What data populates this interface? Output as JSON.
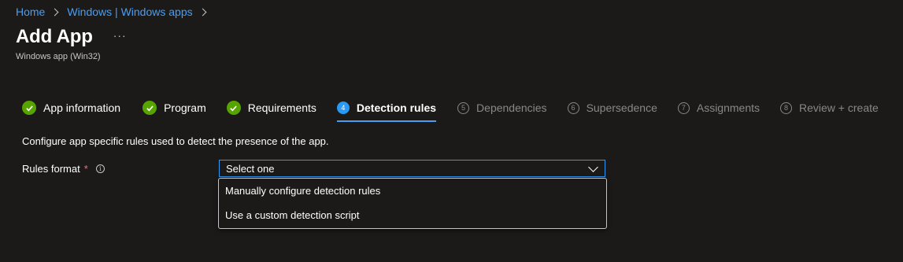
{
  "breadcrumb": [
    {
      "label": "Home"
    },
    {
      "label": "Windows | Windows apps"
    }
  ],
  "page": {
    "title": "Add App",
    "more": "···",
    "subtitle": "Windows app (Win32)"
  },
  "wizard": {
    "steps": [
      {
        "label": "App information",
        "status": "done",
        "icon": "check-circle-icon"
      },
      {
        "label": "Program",
        "status": "done",
        "icon": "check-circle-icon"
      },
      {
        "label": "Requirements",
        "status": "done",
        "icon": "check-circle-icon"
      },
      {
        "label": "Detection rules",
        "status": "active",
        "number": "4"
      },
      {
        "label": "Dependencies",
        "status": "future",
        "number": "5"
      },
      {
        "label": "Supersedence",
        "status": "future",
        "number": "6"
      },
      {
        "label": "Assignments",
        "status": "future",
        "number": "7"
      },
      {
        "label": "Review + create",
        "status": "future",
        "number": "8"
      }
    ]
  },
  "content": {
    "description": "Configure app specific rules used to detect the presence of the app.",
    "rules_format": {
      "label": "Rules format",
      "required_marker": "*",
      "info_icon": "i",
      "selected_value": "Select one",
      "options": [
        "Manually configure detection rules",
        "Use a custom detection script"
      ]
    }
  },
  "colors": {
    "background": "#1b1a19",
    "link": "#479ef5",
    "accent": "#2899f5",
    "success": "#57a300",
    "required": "#f1707b",
    "muted": "#8a8886"
  }
}
